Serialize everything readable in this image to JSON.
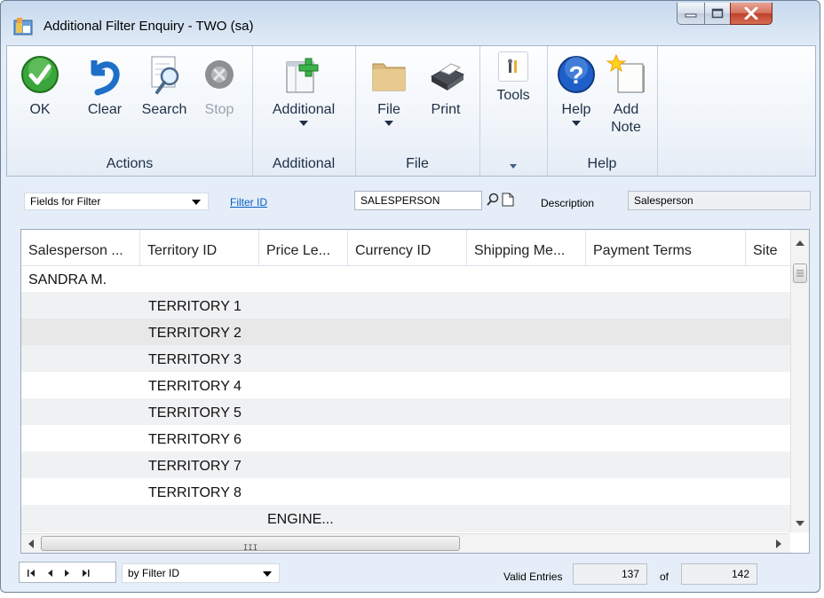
{
  "window": {
    "title": "Additional Filter Enquiry  -  TWO (sa)"
  },
  "ribbon": {
    "actions": {
      "label": "Actions",
      "ok": "OK",
      "clear": "Clear",
      "search": "Search",
      "stop": "Stop"
    },
    "additional": {
      "label": "Additional",
      "button": "Additional"
    },
    "file": {
      "label": "File",
      "file": "File",
      "print": "Print"
    },
    "tools": {
      "button": "Tools"
    },
    "help": {
      "label": "Help",
      "help": "Help",
      "add_note_1": "Add",
      "add_note_2": "Note"
    }
  },
  "filter": {
    "fields_combo": "Fields for Filter",
    "filter_id_link": "Filter ID",
    "filter_id_value": "SALESPERSON",
    "description_label": "Description",
    "description_value": "Salesperson"
  },
  "grid": {
    "columns": [
      "Salesperson ...",
      "Territory ID",
      "Price Le...",
      "Currency ID",
      "Shipping Me...",
      "Payment Terms",
      "Site"
    ],
    "rows": [
      {
        "salesperson": "SANDRA M.",
        "territory": "",
        "price": ""
      },
      {
        "salesperson": "",
        "territory": "TERRITORY 1",
        "price": ""
      },
      {
        "salesperson": "",
        "territory": "TERRITORY 2",
        "price": ""
      },
      {
        "salesperson": "",
        "territory": "TERRITORY 3",
        "price": ""
      },
      {
        "salesperson": "",
        "territory": "TERRITORY 4",
        "price": ""
      },
      {
        "salesperson": "",
        "territory": "TERRITORY 5",
        "price": ""
      },
      {
        "salesperson": "",
        "territory": "TERRITORY 6",
        "price": ""
      },
      {
        "salesperson": "",
        "territory": "TERRITORY 7",
        "price": ""
      },
      {
        "salesperson": "",
        "territory": "TERRITORY 8",
        "price": ""
      },
      {
        "salesperson": "",
        "territory": "",
        "price": "ENGINE..."
      }
    ],
    "hscroll_grip": "III"
  },
  "status": {
    "sort_combo": "by Filter ID",
    "valid_entries_label": "Valid Entries",
    "valid_entries": "137",
    "of_label": "of",
    "total": "142"
  },
  "colors": {
    "accent": "#0a5fc4",
    "ok_green": "#3aa53a",
    "help_blue": "#1f5fc8"
  }
}
